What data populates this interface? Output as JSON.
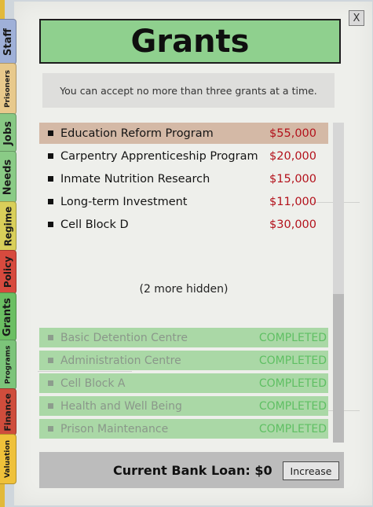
{
  "tabs": [
    {
      "label": "Staff",
      "color": "#9fb0d8"
    },
    {
      "label": "Prisoners",
      "color": "#e8c98c"
    },
    {
      "label": "Jobs",
      "color": "#88c884"
    },
    {
      "label": "Needs",
      "color": "#8acb86"
    },
    {
      "label": "Regime",
      "color": "#d9cf5a"
    },
    {
      "label": "Policy",
      "color": "#d74a3e"
    },
    {
      "label": "Grants",
      "color": "#6bbf63"
    },
    {
      "label": "Programs",
      "color": "#7cc47a"
    },
    {
      "label": "Finance",
      "color": "#cf4d3c"
    },
    {
      "label": "Valuation",
      "color": "#efc13a"
    }
  ],
  "close_label": "X",
  "title": "Grants",
  "notice": "You can accept no more than three grants at a time.",
  "grants": [
    {
      "name": "Education Reform Program",
      "amount": "$55,000",
      "selected": true
    },
    {
      "name": "Carpentry Apprenticeship Program",
      "amount": "$20,000",
      "selected": false
    },
    {
      "name": "Inmate Nutrition Research",
      "amount": "$15,000",
      "selected": false
    },
    {
      "name": "Long-term Investment",
      "amount": "$11,000",
      "selected": false
    },
    {
      "name": "Cell Block D",
      "amount": "$30,000",
      "selected": false
    }
  ],
  "hidden_note": "(2 more hidden)",
  "completed": [
    {
      "name": "Basic Detention Centre",
      "status": "COMPLETED"
    },
    {
      "name": "Administration Centre",
      "status": "COMPLETED"
    },
    {
      "name": "Cell Block A",
      "status": "COMPLETED"
    },
    {
      "name": "Health and Well Being",
      "status": "COMPLETED"
    },
    {
      "name": "Prison Maintenance",
      "status": "COMPLETED"
    }
  ],
  "bank_loan_text": "Current Bank Loan: $0",
  "increase_label": "Increase"
}
